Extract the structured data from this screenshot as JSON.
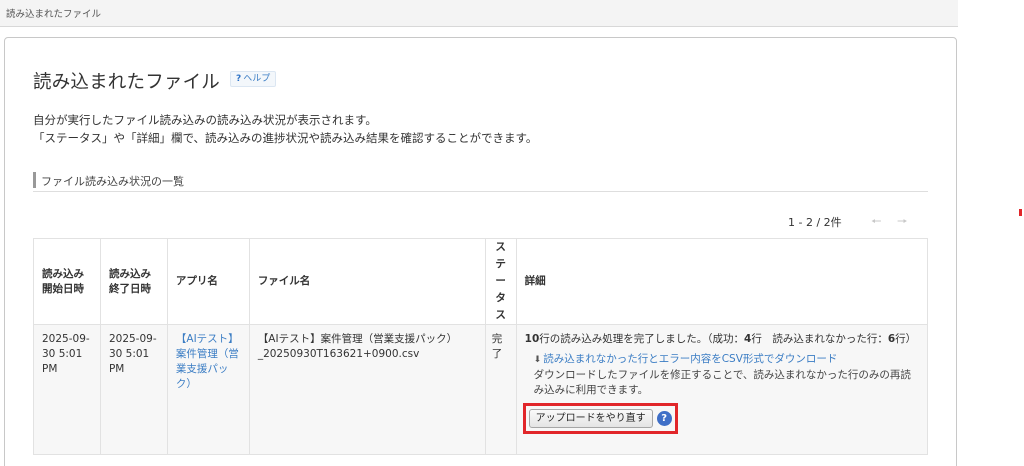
{
  "breadcrumb": {
    "current": "読み込まれたファイル"
  },
  "header": {
    "title": "読み込まれたファイル",
    "help_label": "ヘルプ"
  },
  "description": {
    "line1": "自分が実行したファイル読み込みの読み込み状況が表示されます。",
    "line2": "「ステータス」や「詳細」欄で、読み込みの進捗状況や読み込み結果を確認することができます。"
  },
  "section": {
    "title": "ファイル読み込み状況の一覧"
  },
  "pager": {
    "text": "1 - 2 / 2件"
  },
  "table": {
    "headers": {
      "start_line1": "読み込み",
      "start_line2": "開始日時",
      "end_line1": "読み込み",
      "end_line2": "終了日時",
      "app": "アプリ名",
      "file": "ファイル名",
      "status_chars": [
        "ス",
        "テ",
        "ー",
        "タ",
        "ス"
      ],
      "detail": "詳細"
    },
    "rows": [
      {
        "start": "2025-09-30 5:01 PM",
        "end": "2025-09-30 5:01 PM",
        "app": "【AIテスト】案件管理（営業支援パック）",
        "file": "【AIテスト】案件管理（営業支援パック）_20250930T163621+0900.csv",
        "status": "完了",
        "detail": {
          "total": "10",
          "summary_mid": "行の読み込み処理を完了しました。（成功：",
          "success": "4",
          "summary_mid2": "行　読み込まれなかった行：",
          "failed": "6",
          "summary_end": "行）",
          "download_link": "読み込まれなかった行とエラー内容をCSV形式でダウンロード",
          "download_note": "ダウンロードしたファイルを修正することで、読み込まれなかった行のみの再読み込みに利用できます。",
          "reupload_label": "アップロードをやり直す"
        }
      }
    ]
  },
  "colors": {
    "accent": "#3b7dc4",
    "status_complete": "#2f9a3a",
    "highlight": "#e1262a"
  }
}
